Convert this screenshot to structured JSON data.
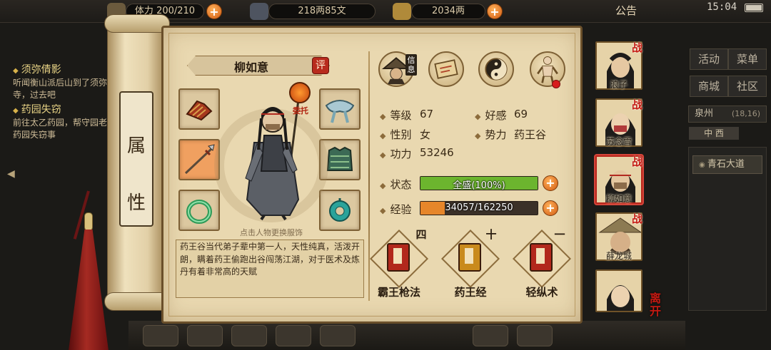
{
  "topbar": {
    "stamina_label": "体力",
    "stamina_value": "200/210",
    "money": "218两85文",
    "silver": "2034两",
    "notice": "公告",
    "clock": "15:04",
    "battery_level": 0.9
  },
  "quests": [
    {
      "title": "须弥倩影",
      "desc": "听闻衡山派后山到了须弥寺，过去吧"
    },
    {
      "title": "药园失窃",
      "desc": "前往太乙药园，帮守园老人药园失窃事"
    }
  ],
  "right_menu": {
    "buttons": [
      "活动",
      "菜单",
      "商城",
      "社区"
    ],
    "location": "泉州",
    "coords": "(18,16)",
    "direction": "中 西",
    "road": "青石大道"
  },
  "scroll_label": [
    "属",
    "性"
  ],
  "character": {
    "name": "柳如意",
    "eval_label": "评",
    "entrust_label": "委托",
    "outfit_hint": "点击人物更换服饰",
    "description": "药王谷当代弟子辈中第一人，天性纯真，活泼开朗，瞒着药王偷跑出谷闯荡江湖，对于医术及炼丹有着非常高的天赋"
  },
  "top_icons": [
    {
      "name": "portrait-icon",
      "tag": "信息"
    },
    {
      "name": "scroll-map-icon",
      "tag": ""
    },
    {
      "name": "bagua-icon",
      "tag": ""
    },
    {
      "name": "meridian-icon",
      "tag": ""
    }
  ],
  "stats": {
    "level_label": "等级",
    "level": "67",
    "favor_label": "好感",
    "favor": "69",
    "gender_label": "性别",
    "gender": "女",
    "faction_label": "势力",
    "faction": "药王谷",
    "power_label": "功力",
    "power": "53246",
    "status_label": "状态",
    "status_text": "全盛(100%)",
    "status_fraction": 1.0,
    "exp_label": "经验",
    "exp_text": "34057/162250",
    "exp_fraction": 0.21
  },
  "skills": [
    {
      "rank": "四",
      "name": "霸王枪法",
      "color": "#b2281c"
    },
    {
      "rank": "十",
      "name": "药王经",
      "color": "#c98a1c"
    },
    {
      "rank": "一",
      "name": "轻纵术",
      "color": "#b2281c"
    }
  ],
  "companions": [
    {
      "name": "浪子",
      "battle": "战"
    },
    {
      "name": "苏念雪",
      "battle": "战"
    },
    {
      "name": "柳如意",
      "battle": "战"
    },
    {
      "name": "薛龙城",
      "battle": "战"
    },
    {
      "name": "",
      "battle": ""
    }
  ],
  "leave_label": "离开",
  "colors": {
    "status_bar": "#6cb52e",
    "exp_bar": "#e6862a",
    "accent_red": "#b82b1d",
    "parchment": "#e9d8b0"
  }
}
